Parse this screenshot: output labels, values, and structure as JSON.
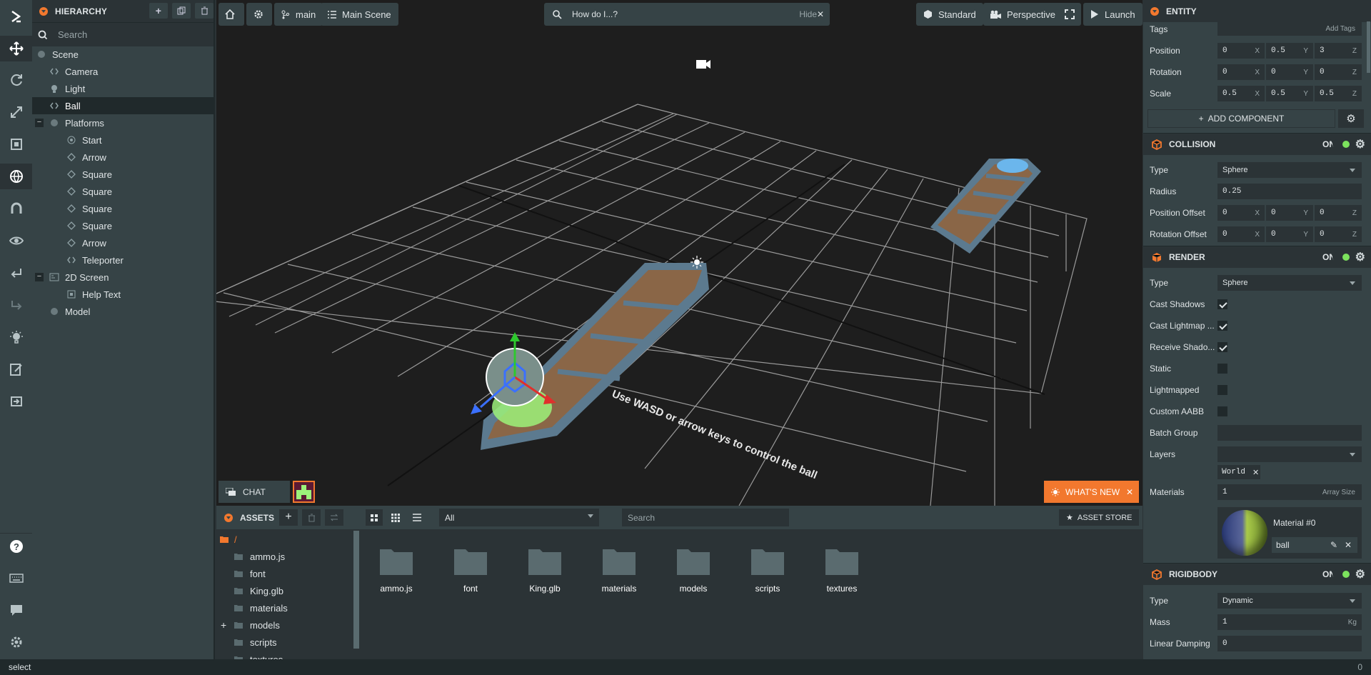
{
  "toolbar": {
    "items": [
      "logo-icon",
      "move-icon",
      "rotate-icon",
      "scale-icon",
      "resize-icon",
      "world-icon",
      "snap-icon",
      "preview-icon",
      "undo-icon",
      "redo-icon",
      "light-icon",
      "edit-icon",
      "export-icon",
      "help-icon",
      "keyboard-icon",
      "comment-icon",
      "settings-icon"
    ]
  },
  "hierarchy": {
    "title": "HIERARCHY",
    "search_placeholder": "Search",
    "items": [
      {
        "label": "Scene",
        "icon": "dot",
        "depth": 0
      },
      {
        "label": "Camera",
        "icon": "entity",
        "depth": 1
      },
      {
        "label": "Light",
        "icon": "light",
        "depth": 1
      },
      {
        "label": "Ball",
        "icon": "entity",
        "depth": 1
      },
      {
        "label": "Platforms",
        "icon": "dot",
        "depth": 1
      },
      {
        "label": "Start",
        "icon": "template",
        "depth": 2
      },
      {
        "label": "Arrow",
        "icon": "diamond",
        "depth": 2
      },
      {
        "label": "Square",
        "icon": "diamond",
        "depth": 2
      },
      {
        "label": "Square",
        "icon": "diamond",
        "depth": 2
      },
      {
        "label": "Square",
        "icon": "diamond",
        "depth": 2
      },
      {
        "label": "Square",
        "icon": "diamond",
        "depth": 2
      },
      {
        "label": "Arrow",
        "icon": "diamond",
        "depth": 2
      },
      {
        "label": "Teleporter",
        "icon": "entity",
        "depth": 2
      },
      {
        "label": "2D Screen",
        "icon": "screen",
        "depth": 1
      },
      {
        "label": "Help Text",
        "icon": "element",
        "depth": 2
      },
      {
        "label": "Model",
        "icon": "dot",
        "depth": 1
      }
    ]
  },
  "viewport": {
    "branch": "main",
    "scene": "Main Scene",
    "help_placeholder": "How do I...?",
    "hide_label": "Hide",
    "render_mode": "Standard",
    "camera_mode": "Perspective",
    "launch_label": "Launch",
    "chat_label": "CHAT",
    "whats_new_label": "WHAT'S NEW",
    "scene_text": "Use WASD or arrow keys to control the ball"
  },
  "assets": {
    "title": "ASSETS",
    "filter": "All",
    "search_placeholder": "Search",
    "store_label": "ASSET STORE",
    "root_label": "/",
    "folders": [
      "ammo.js",
      "font",
      "King.glb",
      "materials",
      "models",
      "scripts",
      "textures"
    ],
    "grid": [
      "ammo.js",
      "font",
      "King.glb",
      "materials",
      "models",
      "scripts",
      "textures"
    ]
  },
  "inspector": {
    "title": "ENTITY",
    "tags_label": "Tags",
    "add_tags_label": "Add Tags",
    "position": {
      "label": "Position",
      "x": "0",
      "y": "0.5",
      "z": "3"
    },
    "rotation": {
      "label": "Rotation",
      "x": "0",
      "y": "0",
      "z": "0"
    },
    "scale": {
      "label": "Scale",
      "x": "0.5",
      "y": "0.5",
      "z": "0.5"
    },
    "add_component_label": "ADD COMPONENT",
    "collision": {
      "title": "COLLISION",
      "on_label": "ON",
      "type_label": "Type",
      "type": "Sphere",
      "radius_label": "Radius",
      "radius": "0.25",
      "pos_offset_label": "Position Offset",
      "pos_offset": {
        "x": "0",
        "y": "0",
        "z": "0"
      },
      "rot_offset_label": "Rotation Offset",
      "rot_offset": {
        "x": "0",
        "y": "0",
        "z": "0"
      }
    },
    "render": {
      "title": "RENDER",
      "on_label": "ON",
      "type_label": "Type",
      "type": "Sphere",
      "cast_shadows": "Cast Shadows",
      "cast_lightmap": "Cast Lightmap ...",
      "receive_shadows": "Receive Shado...",
      "static": "Static",
      "lightmapped": "Lightmapped",
      "custom_aabb": "Custom AABB",
      "batch_group": "Batch Group",
      "layers": "Layers",
      "layer_tag": "World",
      "materials_label": "Materials",
      "materials_count": "1",
      "array_size": "Array Size",
      "material_name": "Material #0",
      "material_asset": "ball"
    },
    "rigidbody": {
      "title": "RIGIDBODY",
      "on_label": "ON",
      "type_label": "Type",
      "type": "Dynamic",
      "mass_label": "Mass",
      "mass": "1",
      "mass_unit": "Kg",
      "linear_damping_label": "Linear Damping",
      "linear_damping": "0"
    }
  },
  "status": {
    "text": "select",
    "count": "0"
  },
  "colors": {
    "accent": "#f2782e",
    "toggle_on": "#7ce25d",
    "panel": "#364346",
    "dark": "#2b3336"
  }
}
